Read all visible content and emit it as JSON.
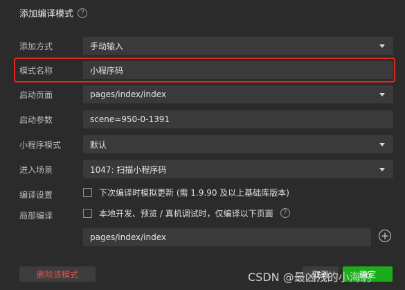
{
  "dialog": {
    "title": "添加编译模式",
    "help_symbol": "?"
  },
  "form": {
    "add_method": {
      "label": "添加方式",
      "value": "手动输入"
    },
    "mode_name": {
      "label": "模式名称",
      "value": "小程序码"
    },
    "start_page": {
      "label": "启动页面",
      "value": "pages/index/index"
    },
    "start_params": {
      "label": "启动参数",
      "value": "scene=950-0-1391"
    },
    "mini_mode": {
      "label": "小程序模式",
      "value": "默认"
    },
    "enter_scene": {
      "label": "进入场景",
      "value": "1047: 扫描小程序码"
    },
    "compile_settings": {
      "label": "编译设置",
      "option_text": "下次编译时模拟更新 (需 1.9.90 及以上基础库版本)",
      "checked": false
    },
    "partial_compile": {
      "label": "局部编译",
      "option_text": "本地开发、预览 / 真机调试时，仅编译以下页面",
      "checked": false,
      "page_value": "pages/index/index"
    }
  },
  "footer": {
    "delete_label": "删除该模式",
    "cancel_label": "取消",
    "confirm_label": "确定"
  },
  "watermark": "CSDN @最凶残的小海豹",
  "colors": {
    "background": "#2b2b2b",
    "field": "#3a3a3a",
    "highlight_border": "#e0281c",
    "confirm": "#1aad19",
    "delete_text": "#e0554e"
  },
  "icons": {
    "help": "question-circle-icon",
    "dropdown": "triangle-down-icon",
    "add": "plus-circle-icon"
  }
}
